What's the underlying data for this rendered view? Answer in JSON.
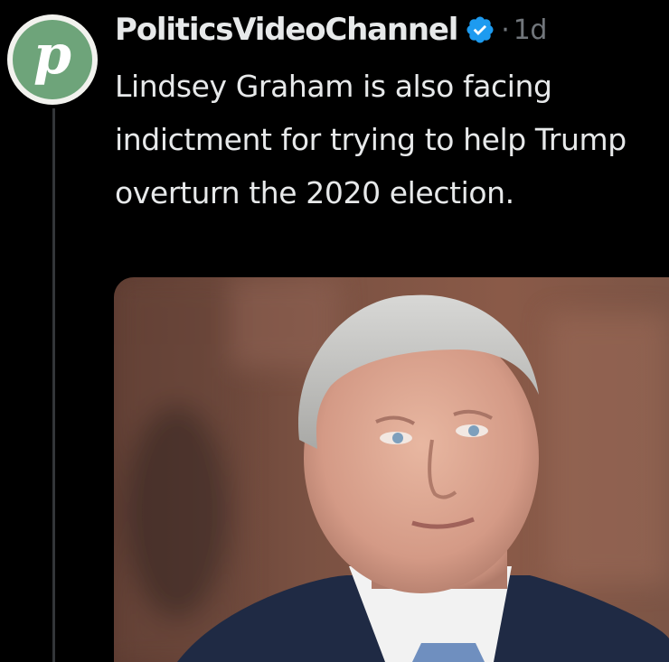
{
  "tweet": {
    "avatar_letter": "p",
    "display_name": "PoliticsVideoChannel",
    "separator": "·",
    "timestamp": "1d",
    "text": "Lindsey Graham is also facing indictment for trying to help Trump overturn the 2020 election.",
    "verified_icon": "verified-badge-icon",
    "media_description_icon": "photo"
  },
  "colors": {
    "background": "#000000",
    "text": "#e7e9ea",
    "muted": "#71767b",
    "verified": "#1d9bf0",
    "avatar_green": "#6ea47a",
    "thread_line": "#333639"
  }
}
